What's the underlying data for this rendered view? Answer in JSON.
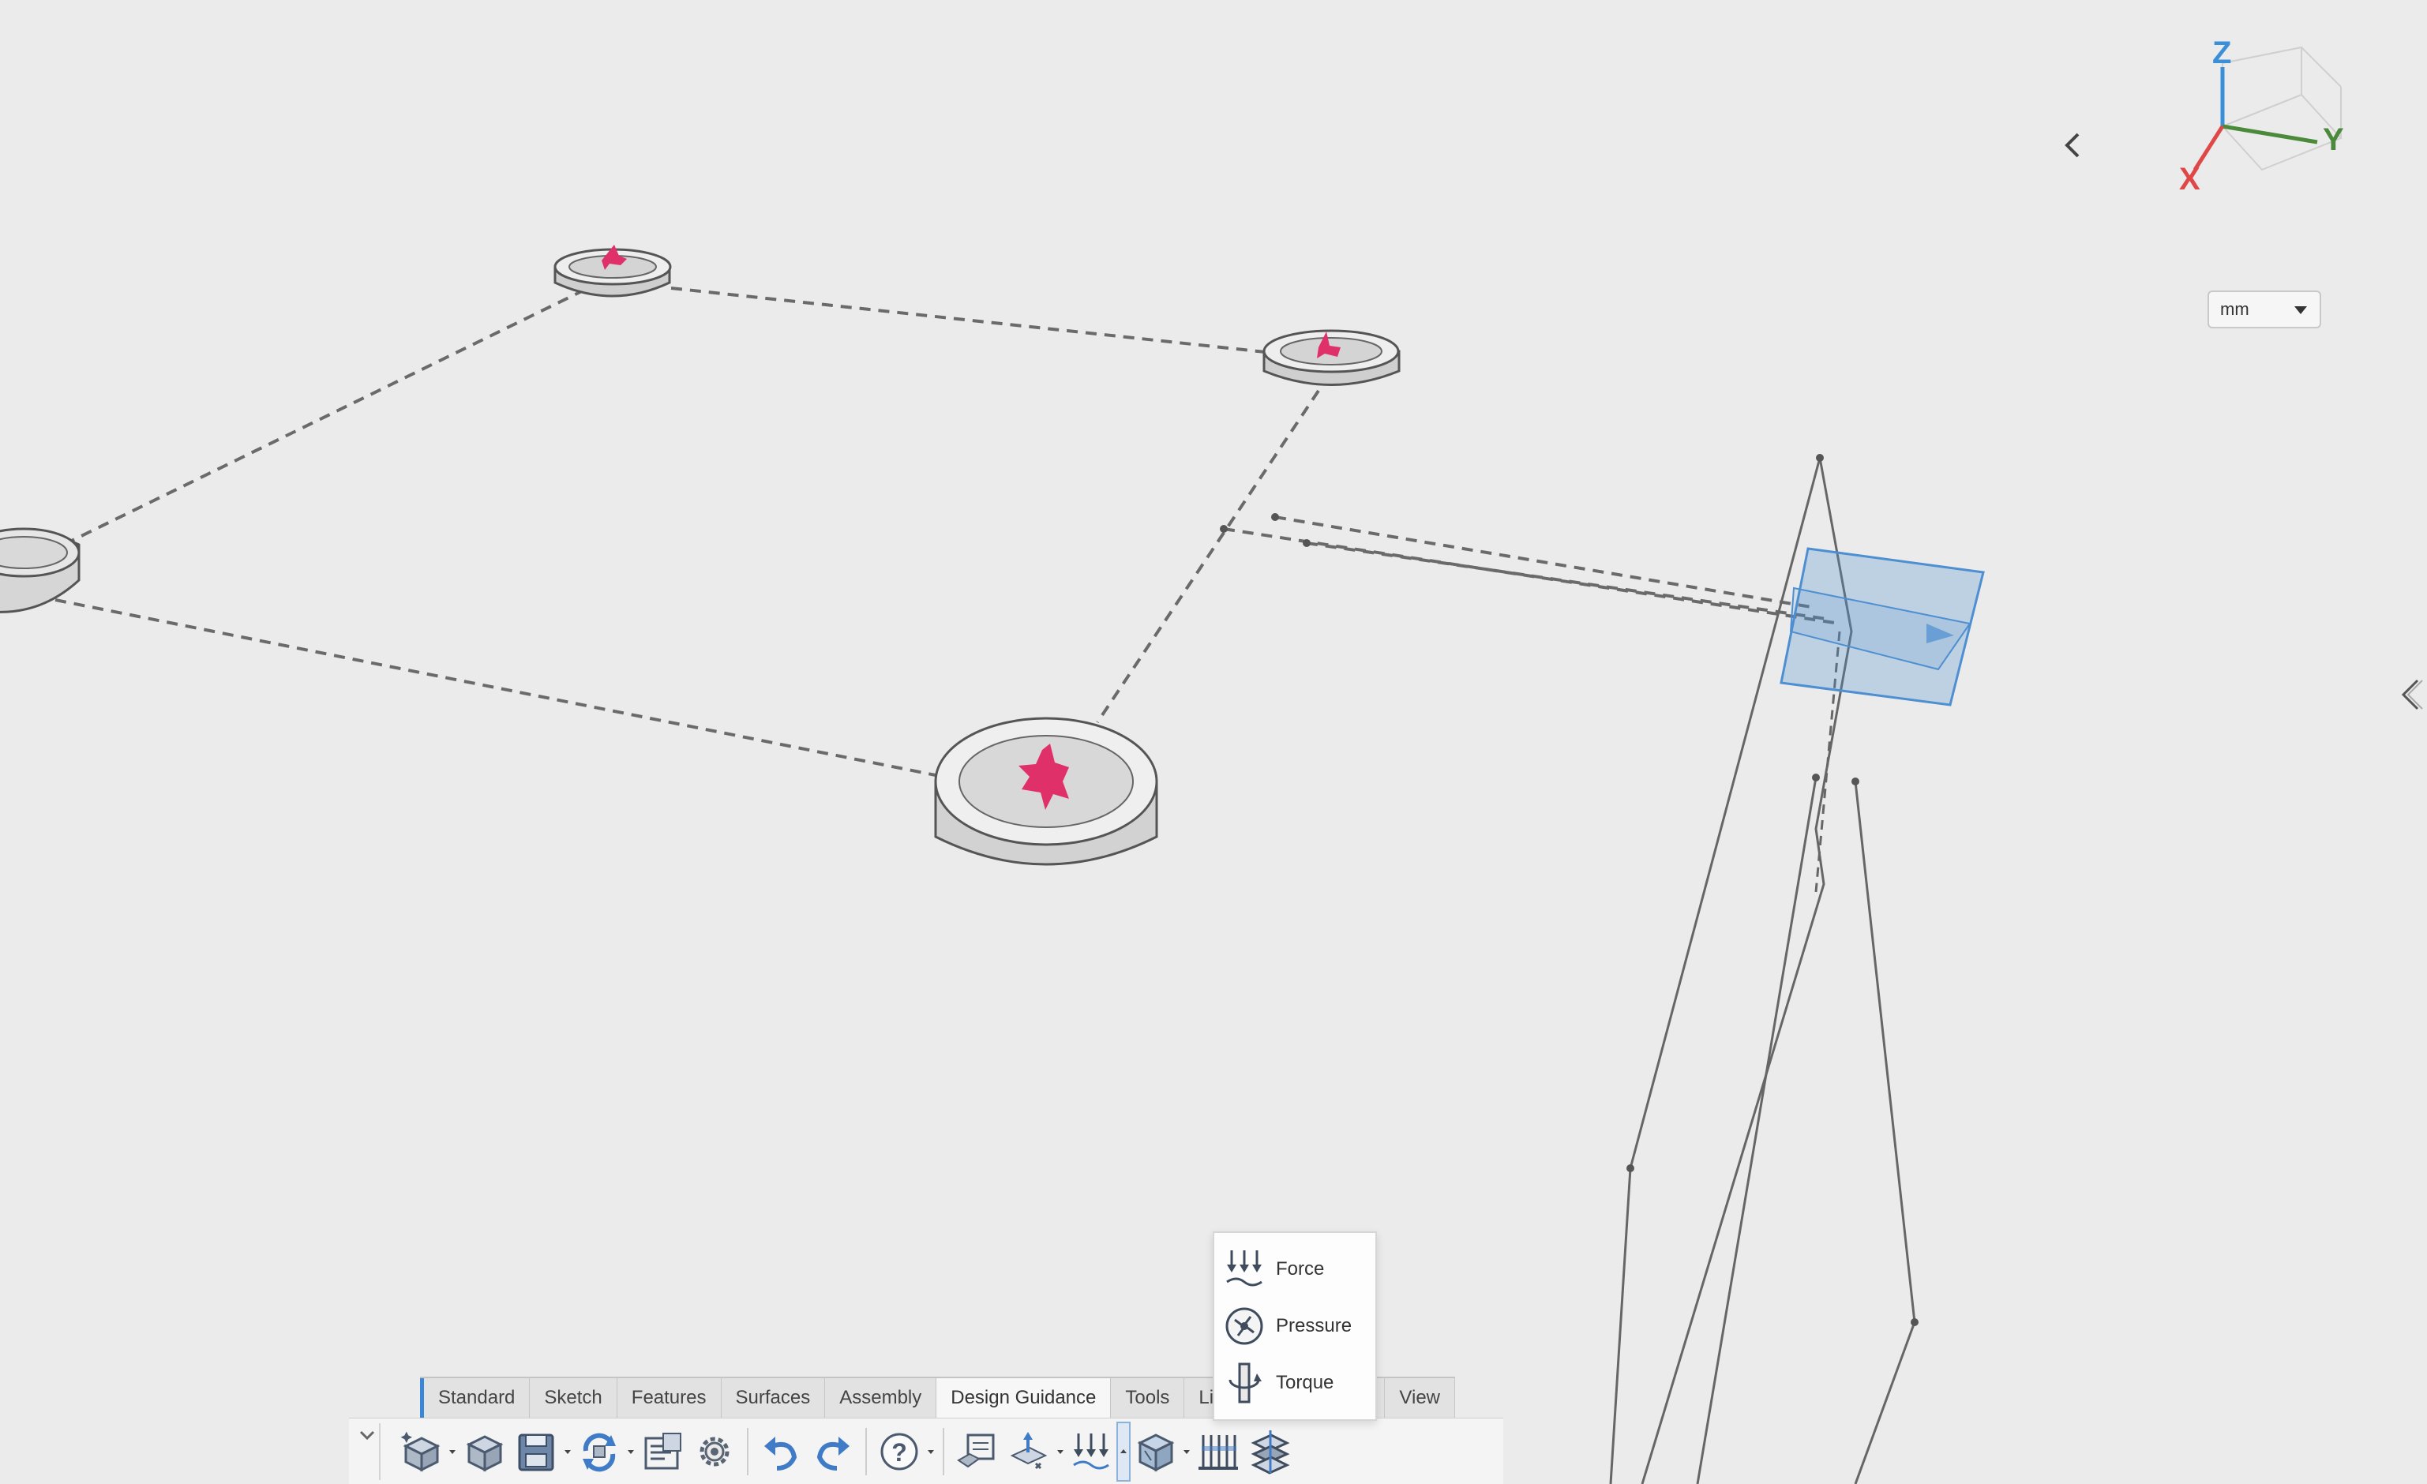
{
  "viewport": {
    "background": "#ebebeb",
    "accent_point_color": "#e0306a",
    "plane_color": "#4d8fd0"
  },
  "view_triad": {
    "z_label": "Z",
    "y_label": "Y",
    "x_label": "X",
    "z_color": "#3a8fd8",
    "y_color": "#4a8a3a",
    "x_color": "#e04848"
  },
  "units": {
    "selected": "mm"
  },
  "tabs": [
    {
      "label": "Standard"
    },
    {
      "label": "Sketch"
    },
    {
      "label": "Features"
    },
    {
      "label": "Surfaces"
    },
    {
      "label": "Assembly"
    },
    {
      "label": "Design Guidance"
    },
    {
      "label": "Tools"
    },
    {
      "label": "Lifec"
    },
    {
      "label": "e"
    },
    {
      "label": "View"
    }
  ],
  "flyout": {
    "items": [
      {
        "label": "Force",
        "icon": "force-icon"
      },
      {
        "label": "Pressure",
        "icon": "pressure-icon"
      },
      {
        "label": "Torque",
        "icon": "torque-icon"
      }
    ]
  },
  "toolbar": {
    "icons": [
      "new-part-icon",
      "open-icon",
      "save-icon",
      "rebuild-icon",
      "properties-icon",
      "options-icon",
      "undo-icon",
      "redo-icon",
      "help-icon",
      "study-icon",
      "constraint-icon",
      "loads-icon",
      "material-icon",
      "results-icon",
      "section-icon"
    ]
  }
}
